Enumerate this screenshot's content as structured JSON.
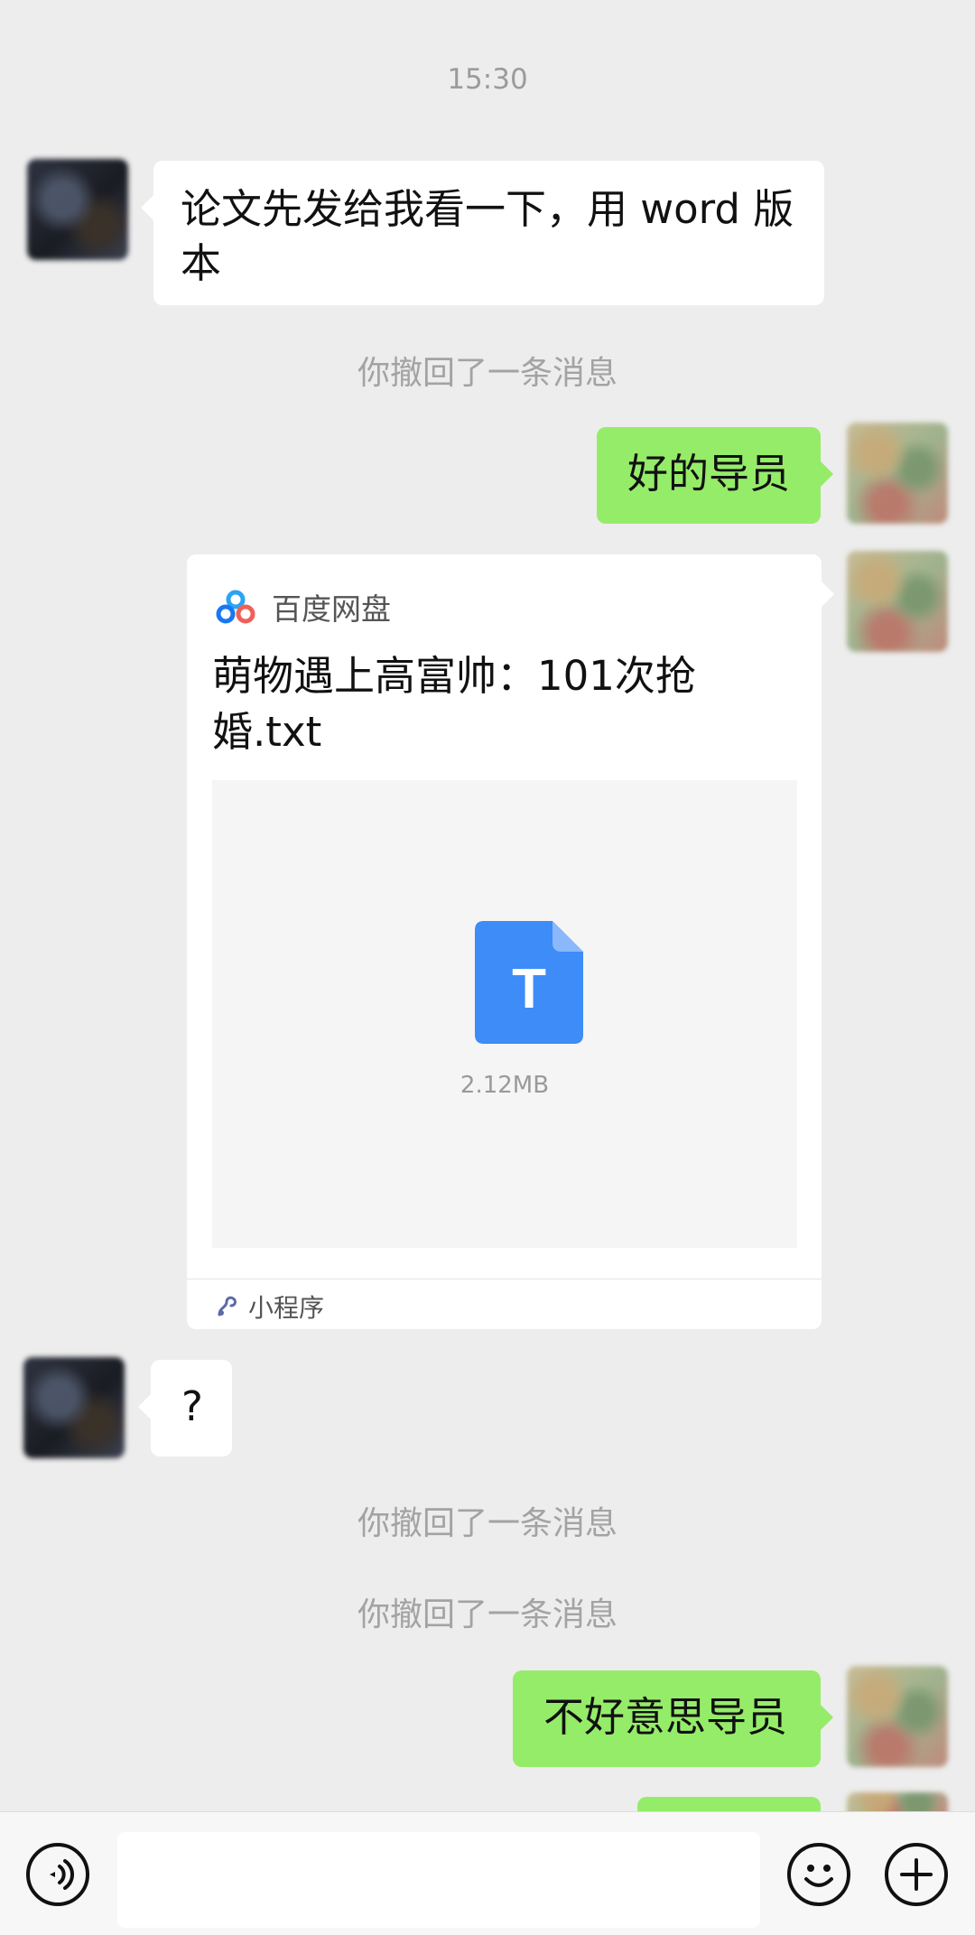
{
  "chat": {
    "timestamp": "15:30",
    "teacher_msg_1": [
      "论文先发给我看一下，用 word 版",
      "本"
    ],
    "recalled_notice": "你撤回了一条消息",
    "my_msg_1": "好的导员",
    "card": {
      "app_name": "百度网盘",
      "title_lines": [
        "萌物遇上高富帅：101次抢",
        "婚.txt"
      ],
      "file_letter": "T",
      "file_size": "2.12MB",
      "footer_label": "小程序"
    },
    "teacher_msg_2": "?",
    "my_msg_2": "不好意思导员"
  },
  "colors": {
    "background": "#ededed",
    "sent_bubble": "#95ec69",
    "received_bubble": "#ffffff",
    "file_icon": "#3d8cf7"
  },
  "icons": {
    "voice": "voice-icon",
    "emoji": "emoji-icon",
    "plus": "plus-icon",
    "baidu": "baidu-netdisk-icon",
    "miniprogram": "miniprogram-icon"
  }
}
